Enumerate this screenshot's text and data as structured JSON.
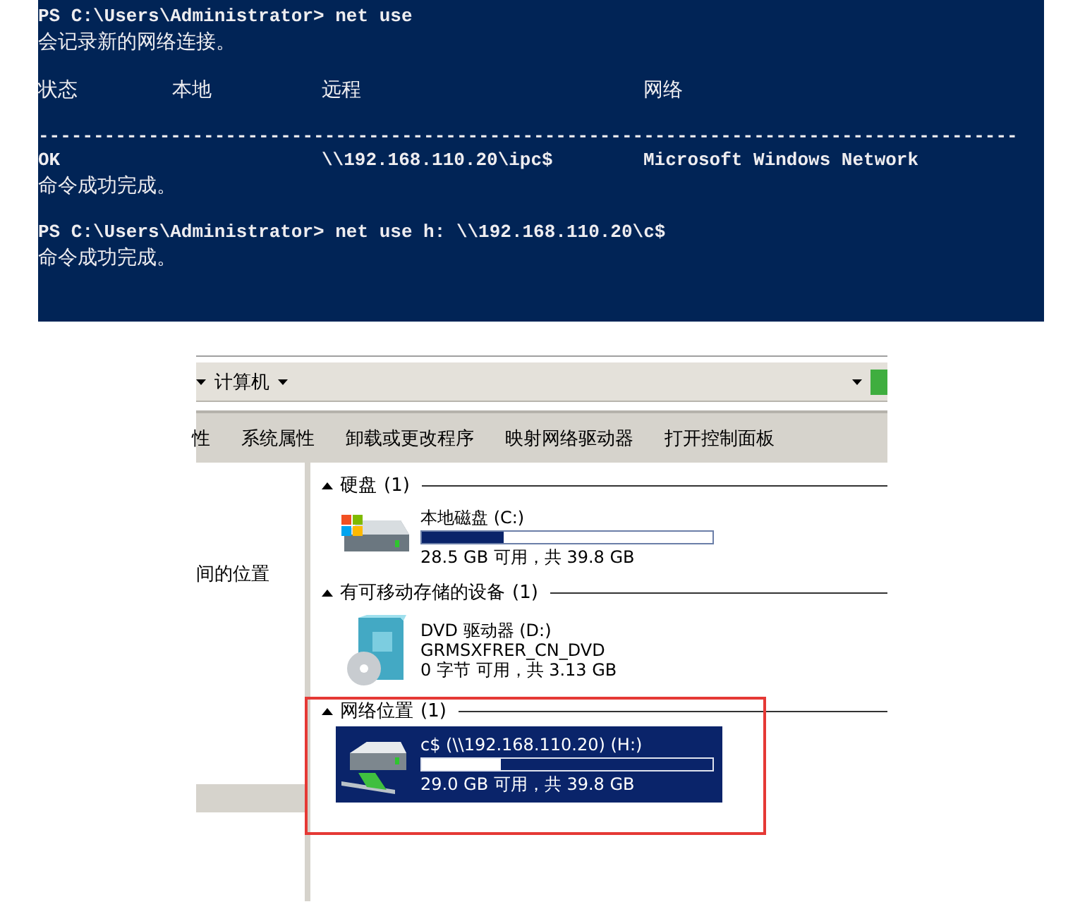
{
  "console": {
    "lines": [
      {
        "kind": "text",
        "text": "PS C:\\Users\\Administrator> net use"
      },
      {
        "kind": "text",
        "text": "会记录新的网络连接。"
      },
      {
        "kind": "blank"
      },
      {
        "kind": "columns",
        "cells": [
          "状态",
          "本地",
          "远程",
          "网络"
        ]
      },
      {
        "kind": "blank"
      },
      {
        "kind": "text",
        "text": "-----------------------------------------------------------------------------------------"
      },
      {
        "kind": "columns",
        "cells": [
          "OK",
          "",
          "\\\\192.168.110.20\\ipc$",
          "Microsoft Windows Network"
        ]
      },
      {
        "kind": "text",
        "text": "命令成功完成。"
      },
      {
        "kind": "blank"
      },
      {
        "kind": "text",
        "text": "PS C:\\Users\\Administrator> net use h: \\\\192.168.110.20\\c$"
      },
      {
        "kind": "text",
        "text": "命令成功完成。"
      }
    ]
  },
  "explorer": {
    "address": "计算机",
    "toolbar": [
      "性",
      "系统属性",
      "卸载或更改程序",
      "映射网络驱动器",
      "打开控制面板"
    ],
    "sidebar_text": "间的位置",
    "groups": [
      {
        "title": "硬盘",
        "count": "(1)",
        "items": [
          {
            "kind": "disk",
            "name": "本地磁盘 (C:)",
            "level": 0.28,
            "space": "28.5 GB 可用，共 39.8 GB",
            "selected": false
          }
        ]
      },
      {
        "title": "有可移动存储的设备",
        "count": "(1)",
        "items": [
          {
            "kind": "dvd",
            "name": "DVD 驱动器 (D:)",
            "label": "GRMSXFRER_CN_DVD",
            "space": "0 字节 可用，共 3.13 GB",
            "selected": false
          }
        ]
      },
      {
        "title": "网络位置",
        "count": "(1)",
        "highlighted": true,
        "items": [
          {
            "kind": "network",
            "name": "c$ (\\\\192.168.110.20) (H:)",
            "level": 0.27,
            "space": "29.0 GB 可用，共 39.8 GB",
            "selected": true
          }
        ]
      }
    ]
  }
}
